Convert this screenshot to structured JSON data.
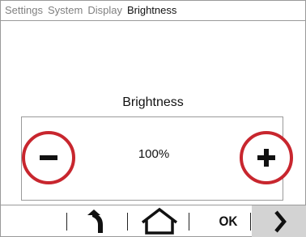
{
  "breadcrumb": {
    "items": [
      "Settings",
      "System",
      "Display"
    ],
    "current": "Brightness"
  },
  "screen_title": "Brightness",
  "brightness": {
    "value_label": "100%",
    "level_percent": 100
  },
  "controls": {
    "decrease_icon": "minus-icon",
    "increase_icon": "plus-icon"
  },
  "nav": {
    "back_icon": "back-arrow-icon",
    "home_icon": "home-icon",
    "ok_label": "OK",
    "next_icon": "chevron-right-icon"
  },
  "colors": {
    "accent_ring": "#c8262e",
    "next_button_bg": "#d3d3d3",
    "border": "#9a9a9a"
  }
}
